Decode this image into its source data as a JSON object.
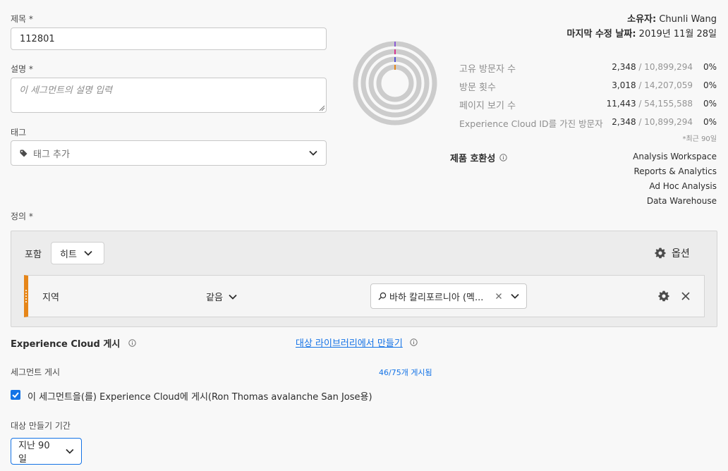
{
  "form": {
    "title_label": "제목 *",
    "title_value": "112801",
    "desc_label": "설명 *",
    "desc_placeholder": "이 세그먼트의 설명 입력",
    "tag_label": "태그",
    "tag_placeholder": "태그 추가",
    "definition_label": "정의 *"
  },
  "owner": {
    "owner_label": "소유자:",
    "owner_name": "Chunli Wang",
    "modified_label": "마지막 수정 날짜:",
    "modified_date": "2019년 11월 28일"
  },
  "metrics": [
    {
      "name": "고유 방문자 수",
      "value": "2,348",
      "total": " / 10,899,294",
      "pct": "0%"
    },
    {
      "name": "방문 횟수",
      "value": "3,018",
      "total": " / 14,207,059",
      "pct": "0%"
    },
    {
      "name": "페이지 보기 수",
      "value": "11,443",
      "total": " / 54,155,588",
      "pct": "0%"
    },
    {
      "name": "Experience Cloud ID를 가진 방문자",
      "value": "2,348",
      "total": " / 10,899,294",
      "pct": "0%"
    }
  ],
  "metrics_note": "*최근 90일",
  "compatibility": {
    "label": "제품 호환성",
    "products": [
      "Analysis Workspace",
      "Reports & Analytics",
      "Ad Hoc Analysis",
      "Data Warehouse"
    ]
  },
  "definition": {
    "include_label": "포함",
    "container": "히트",
    "options_label": "옵션",
    "rule": {
      "dimension": "지역",
      "operator": "같음",
      "value": "바하 칼리포르니아 (멕..."
    }
  },
  "publish": {
    "ec_label": "Experience Cloud 게시",
    "library_link": "대상 라이브러리에서 만들기",
    "segment_publish_label": "세그먼트 게시",
    "publish_count": "46/75개 게시됨",
    "checkbox_label": "이 세그먼트을(를) Experience Cloud에 게시(Ron Thomas avalanche San Jose용)",
    "checkbox_checked": true,
    "period_label": "대상 만들기 기간",
    "period_value": "지난 90일"
  },
  "colors": {
    "accent": "#1473e6",
    "rule_bar": "#e68619",
    "ring": "#cccccc"
  }
}
